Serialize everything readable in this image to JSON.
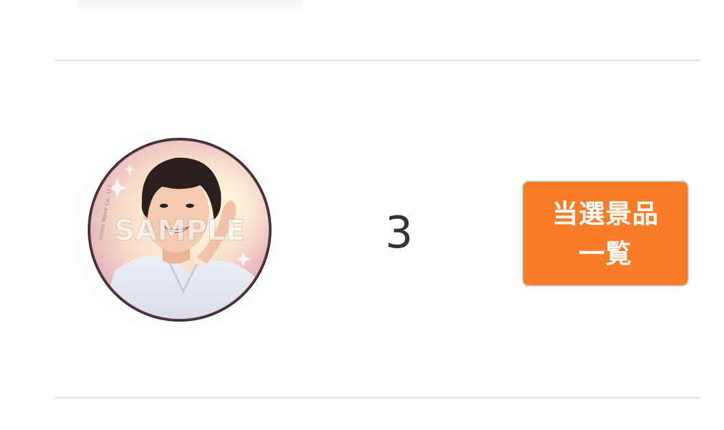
{
  "item": {
    "image_label": "can-badge-sample",
    "watermark": "SAMPLE",
    "copyright": "Osmo Wave Co., Ltd.",
    "count": "3",
    "button_line1": "当選景品",
    "button_line2": "一覧"
  },
  "colors": {
    "button_bg": "#f97d28",
    "button_text": "#ffffff",
    "count_text": "#333333",
    "divider": "#e4e4e4"
  }
}
